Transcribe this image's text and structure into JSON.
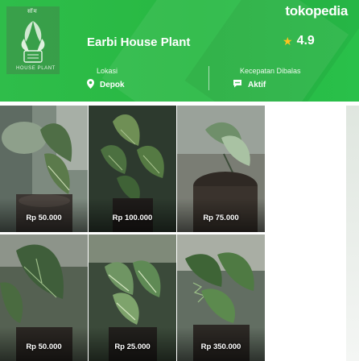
{
  "brand": "tokopedia",
  "store": {
    "name": "Earbi House Plant",
    "rating": "4.9",
    "logo_top": "सॉम",
    "logo_bottom": "HOUSE PLANT"
  },
  "info": {
    "location_label": "Lokasi",
    "location_value": "Depok",
    "speed_label": "Kecepatan Dibalas",
    "speed_value": "Aktif"
  },
  "products": [
    {
      "price": "Rp 50.000"
    },
    {
      "price": "Rp 100.000"
    },
    {
      "price": "Rp 75.000"
    },
    {
      "price": "Rp 50.000"
    },
    {
      "price": "Rp 25.000"
    },
    {
      "price": "Rp 350.000"
    }
  ],
  "colors": {
    "brand_green": "#27b842",
    "star": "#ffc21f"
  },
  "icons": {
    "rating": "star-icon",
    "location": "location-pin-icon",
    "speed": "chat-bubble-icon"
  }
}
